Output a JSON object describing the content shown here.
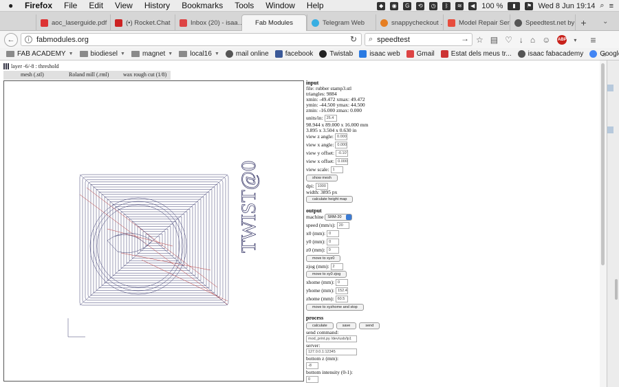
{
  "menubar": {
    "apple": "",
    "items": [
      "Firefox",
      "File",
      "Edit",
      "View",
      "History",
      "Bookmarks",
      "Tools",
      "Window",
      "Help"
    ],
    "battery": "100 %",
    "datetime": "Wed 8 Jun  19:14"
  },
  "tabs": [
    {
      "label": "aoc_laserguide.pdf",
      "color": "#d33",
      "active": false
    },
    {
      "label": "(•) Rocket.Chat",
      "color": "#c22",
      "active": false
    },
    {
      "label": "Inbox (20) - isaa…",
      "color": "#d44",
      "active": false
    },
    {
      "label": "Fab Modules",
      "color": "#fff",
      "active": true
    },
    {
      "label": "Telegram Web",
      "color": "#37aee2",
      "active": false
    },
    {
      "label": "snappycheckout …",
      "color": "#e67e22",
      "active": false
    },
    {
      "label": "Model Repair Ser…",
      "color": "#e74c3c",
      "active": false
    },
    {
      "label": "Speedtest.net by…",
      "color": "#555",
      "active": false
    }
  ],
  "nav": {
    "back": "←",
    "url": "fabmodules.org",
    "reload": "↻",
    "search_value": "speedtest",
    "search_go": "→",
    "info": "i"
  },
  "bookmarks": [
    {
      "label": "FAB ACADEMY",
      "folder": true,
      "color": "#888"
    },
    {
      "label": "biodiesel",
      "folder": true,
      "color": "#888"
    },
    {
      "label": "magnet",
      "folder": true,
      "color": "#888"
    },
    {
      "label": "local16",
      "folder": true,
      "color": "#888"
    },
    {
      "label": "mail online",
      "folder": false,
      "color": "#555"
    },
    {
      "label": "facebook",
      "folder": false,
      "color": "#3b5998"
    },
    {
      "label": "Twistab",
      "folder": false,
      "color": "#222"
    },
    {
      "label": "isaac web",
      "folder": false,
      "color": "#2a7ae2"
    },
    {
      "label": "Gmail",
      "folder": false,
      "color": "#d44"
    },
    {
      "label": "Estat dels meus tr...",
      "folder": false,
      "color": "#c33"
    },
    {
      "label": "isaac fabacademy",
      "folder": false,
      "color": "#555"
    },
    {
      "label": "Google",
      "folder": false,
      "color": "#4285f4"
    }
  ],
  "bookmarks_more": "»",
  "page": {
    "layer_line": "layer -6/-8 : threshold",
    "toolstrip": [
      "mesh (.stl)",
      "Roland mill (.rml)",
      "wax rough cut (1/8)"
    ],
    "input": {
      "heading": "input",
      "file": "file: rubber stamp3.stl",
      "triangles": "triangles: 9884",
      "xrange": "xmin: -49.472 xmax: 49.472",
      "yrange": "ymin: -44.500 ymax: 44.500",
      "zrange": "zmin: -16.000 zmax: 0.000",
      "units_label": "units/in:",
      "units_value": "25.4",
      "size_mm": "98.944 x 89.000 x 16.000 mm",
      "size_in": "3.895 x 3.504 x 0.630 in",
      "view_z_label": "view z angle:",
      "view_z": "0.000",
      "view_x_label": "view x angle:",
      "view_x": "0.000",
      "view_y_off_label": "view y offset:",
      "view_y_off": "-0.10'",
      "view_x_off_label": "view x offset:",
      "view_x_off": "0.000",
      "view_scale_label": "view scale:",
      "view_scale": "1",
      "show_mesh": "show mesh",
      "dpi_label": "dpi:",
      "dpi": "1000",
      "width": "width: 3895 px",
      "calc_height": "calculate height map"
    },
    "output": {
      "heading": "output",
      "machine_label": "machine",
      "machine": "SRM-20",
      "speed_label": "speed (mm/s):",
      "speed": "20",
      "x0_label": "x0 (mm):",
      "x0": "0",
      "y0_label": "y0 (mm):",
      "y0": "0",
      "z0_label": "z0 (mm):",
      "z0": "0",
      "move_xyz0": "move to xyz0",
      "zjog_label": "zjog (mm):",
      "zjog": "2",
      "move_xy0": "move to xy0 zjog",
      "xhome_label": "xhome (mm):",
      "xhome": "0",
      "yhome_label": "yhome (mm):",
      "yhome": "152.4",
      "zhome_label": "zhome (mm):",
      "zhome": "60.5",
      "move_home": "move to xyzhome and stop"
    },
    "process": {
      "heading": "process",
      "calculate": "calculate",
      "save": "save",
      "send": "send",
      "send_cmd_label": "send command:",
      "send_cmd": "mod_print.py /dev/usb/lp1",
      "server_label": "server:",
      "server": "127.0.0.1:12345",
      "bottom_z_label": "bottom z (mm):",
      "bottom_z": "-8",
      "bottom_intensity_label": "bottom intensity (0-1):",
      "bottom_intensity": "0"
    },
    "stamp_text": "TWIST@0"
  }
}
